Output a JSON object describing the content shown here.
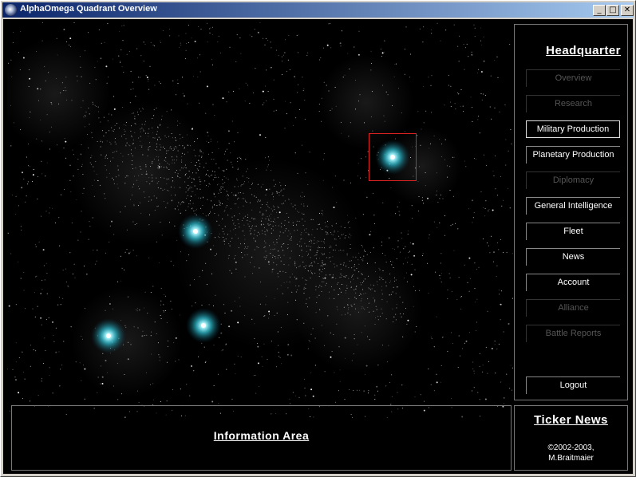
{
  "window": {
    "title": "AlphaOmega Quadrant Overview",
    "controls": {
      "minimize": "_",
      "maximize": "□",
      "close": "✕"
    }
  },
  "sidebar": {
    "title": "Headquarter",
    "items": [
      {
        "label": "Overview",
        "state": "disabled"
      },
      {
        "label": "Research",
        "state": "disabled"
      },
      {
        "label": "Military Production",
        "state": "active"
      },
      {
        "label": "Planetary Production",
        "state": "enabled"
      },
      {
        "label": "Diplomacy",
        "state": "disabled"
      },
      {
        "label": "General Intelligence",
        "state": "enabled"
      },
      {
        "label": "Fleet",
        "state": "enabled"
      },
      {
        "label": "News",
        "state": "enabled"
      },
      {
        "label": "Account",
        "state": "enabled"
      },
      {
        "label": "Alliance",
        "state": "disabled"
      },
      {
        "label": "Battle Reports",
        "state": "disabled"
      }
    ],
    "logout": "Logout"
  },
  "info_area": {
    "title": "Information Area"
  },
  "ticker": {
    "title": "Ticker News",
    "copyright_line1": "©2002-2003,",
    "copyright_line2": "M.Braitmaier"
  },
  "colors": {
    "space": "#000000",
    "galaxy_glow": "#32d2e6",
    "selection": "#dd2222",
    "disabled_text": "#555555"
  }
}
